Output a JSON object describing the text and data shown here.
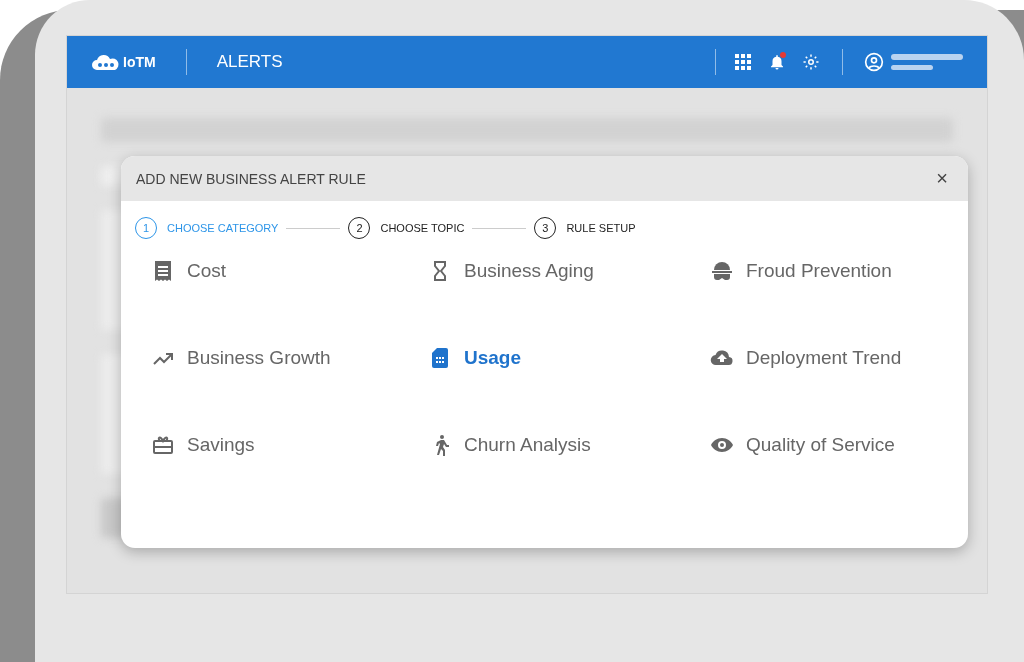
{
  "header": {
    "logo": "IoTM",
    "title": "ALERTS",
    "notifications": {
      "unread": true
    }
  },
  "dialog": {
    "title": "ADD NEW BUSINESS ALERT RULE",
    "close": "×",
    "steps": [
      {
        "number": "1",
        "label": "CHOOSE CATEGORY",
        "selected": true
      },
      {
        "number": "2",
        "label": "CHOOSE TOPIC",
        "selected": false
      },
      {
        "number": "3",
        "label": "RULE SETUP",
        "selected": false
      }
    ],
    "categories": [
      {
        "label": "Cost",
        "selected": false
      },
      {
        "label": "Business Aging",
        "selected": false
      },
      {
        "label": "Froud Prevention",
        "selected": false
      },
      {
        "label": "Business Growth",
        "selected": false
      },
      {
        "label": "Usage",
        "selected": true
      },
      {
        "label": "Deployment Trend",
        "selected": false
      },
      {
        "label": "Savings",
        "selected": false
      },
      {
        "label": "Churn Analysis",
        "selected": false
      },
      {
        "label": "Quality of Service",
        "selected": false
      }
    ]
  }
}
